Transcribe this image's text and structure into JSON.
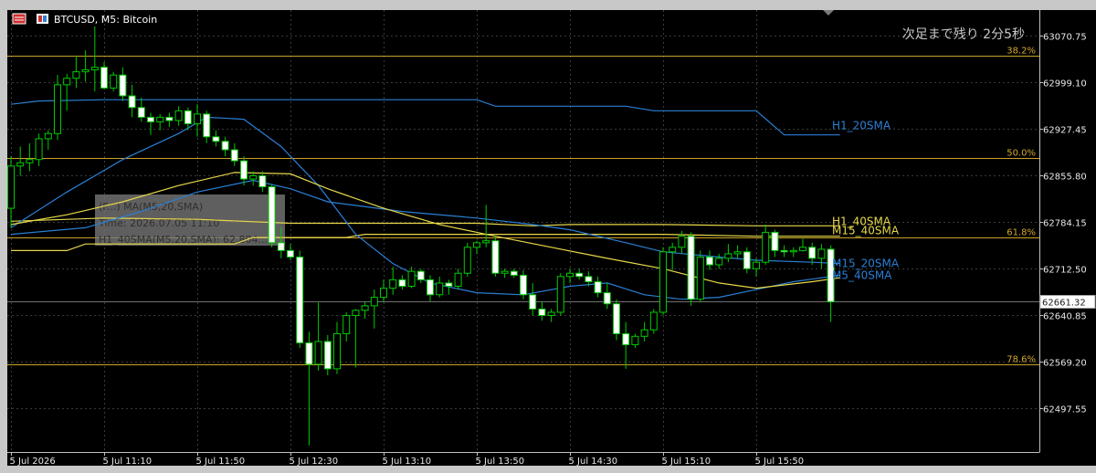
{
  "header": {
    "symbol": "BTCUSD, M5:  Bitcoin",
    "countdown": "次足まで残り 2分5秒"
  },
  "colors": {
    "background": "#000000",
    "frame": "#c8c8c8",
    "grid": "#3a3a3a",
    "bull_body": "#000000",
    "bull_wick": "#00cc00",
    "bear_body": "#ffffff",
    "fib": "#c9a227",
    "ma_blue": "#2a7fd4",
    "ma_yellow": "#e6d84a",
    "price_line": "#707070"
  },
  "tooltip": {
    "line1": "(F...)  MA(M5,20,SMA)",
    "line2": "Time: 2026.07.05 11:10",
    "line3": "H1_40SMA(M5,20,SMA): 62,804..."
  },
  "chart_data": {
    "type": "candlestick",
    "title": "BTCUSD, M5:  Bitcoin",
    "xlabel": "",
    "ylabel": "",
    "ylim": [
      62430,
      63110
    ],
    "grid": true,
    "price_axis": {
      "ticks": [
        63070.75,
        62999.1,
        62927.45,
        62855.8,
        62784.15,
        62712.5,
        62640.85,
        62569.2,
        62497.55
      ],
      "tick_labels": [
        "63070.75",
        "62999.10",
        "62927.45",
        "62855.80",
        "62784.15",
        "62712.50",
        "62640.85",
        "62569.20",
        "62497.55"
      ],
      "current_price": 62661.32,
      "current_price_label": "62661.32"
    },
    "time_axis": {
      "labels": [
        "5 Jul 2026",
        "5 Jul 11:10",
        "5 Jul 11:50",
        "5 Jul 12:30",
        "5 Jul 13:10",
        "5 Jul 13:50",
        "5 Jul 14:30",
        "5 Jul 15:10",
        "5 Jul 15:50"
      ],
      "bar_index": [
        0,
        10,
        20,
        30,
        40,
        50,
        60,
        70,
        80
      ]
    },
    "bars_total": 89,
    "candles": [
      {
        "o": 62805,
        "h": 62885,
        "l": 62775,
        "c": 62870
      },
      {
        "o": 62870,
        "h": 62900,
        "l": 62855,
        "c": 62875
      },
      {
        "o": 62875,
        "h": 62905,
        "l": 62862,
        "c": 62880
      },
      {
        "o": 62880,
        "h": 62920,
        "l": 62870,
        "c": 62912
      },
      {
        "o": 62912,
        "h": 62925,
        "l": 62895,
        "c": 62920
      },
      {
        "o": 62920,
        "h": 63010,
        "l": 62910,
        "c": 62995
      },
      {
        "o": 62995,
        "h": 63012,
        "l": 62955,
        "c": 63005
      },
      {
        "o": 63005,
        "h": 63040,
        "l": 62990,
        "c": 63015
      },
      {
        "o": 63015,
        "h": 63048,
        "l": 63000,
        "c": 63018
      },
      {
        "o": 63018,
        "h": 63085,
        "l": 62985,
        "c": 63022
      },
      {
        "o": 63022,
        "h": 63030,
        "l": 62988,
        "c": 62990
      },
      {
        "o": 62990,
        "h": 63015,
        "l": 62985,
        "c": 63010
      },
      {
        "o": 63010,
        "h": 63022,
        "l": 62970,
        "c": 62978
      },
      {
        "o": 62978,
        "h": 62995,
        "l": 62945,
        "c": 62960
      },
      {
        "o": 62960,
        "h": 62975,
        "l": 62938,
        "c": 62945
      },
      {
        "o": 62945,
        "h": 62952,
        "l": 62918,
        "c": 62938
      },
      {
        "o": 62938,
        "h": 62950,
        "l": 62925,
        "c": 62945
      },
      {
        "o": 62945,
        "h": 62952,
        "l": 62930,
        "c": 62940
      },
      {
        "o": 62940,
        "h": 62962,
        "l": 62932,
        "c": 62955
      },
      {
        "o": 62955,
        "h": 62960,
        "l": 62925,
        "c": 62935
      },
      {
        "o": 62935,
        "h": 62965,
        "l": 62915,
        "c": 62950
      },
      {
        "o": 62950,
        "h": 62955,
        "l": 62905,
        "c": 62915
      },
      {
        "o": 62915,
        "h": 62925,
        "l": 62900,
        "c": 62908
      },
      {
        "o": 62908,
        "h": 62915,
        "l": 62885,
        "c": 62895
      },
      {
        "o": 62895,
        "h": 62905,
        "l": 62870,
        "c": 62878
      },
      {
        "o": 62878,
        "h": 62885,
        "l": 62840,
        "c": 62850
      },
      {
        "o": 62850,
        "h": 62862,
        "l": 62840,
        "c": 62855
      },
      {
        "o": 62855,
        "h": 62862,
        "l": 62830,
        "c": 62838
      },
      {
        "o": 62838,
        "h": 62842,
        "l": 62745,
        "c": 62752
      },
      {
        "o": 62752,
        "h": 62775,
        "l": 62728,
        "c": 62740
      },
      {
        "o": 62740,
        "h": 62750,
        "l": 62725,
        "c": 62730
      },
      {
        "o": 62730,
        "h": 62740,
        "l": 62590,
        "c": 62598
      },
      {
        "o": 62598,
        "h": 62615,
        "l": 62440,
        "c": 62565
      },
      {
        "o": 62565,
        "h": 62660,
        "l": 62555,
        "c": 62600
      },
      {
        "o": 62600,
        "h": 62610,
        "l": 62548,
        "c": 62558
      },
      {
        "o": 62558,
        "h": 62630,
        "l": 62550,
        "c": 62612
      },
      {
        "o": 62612,
        "h": 62645,
        "l": 62600,
        "c": 62640
      },
      {
        "o": 62640,
        "h": 62650,
        "l": 62560,
        "c": 62648
      },
      {
        "o": 62648,
        "h": 62662,
        "l": 62635,
        "c": 62655
      },
      {
        "o": 62655,
        "h": 62680,
        "l": 62620,
        "c": 62668
      },
      {
        "o": 62668,
        "h": 62695,
        "l": 62660,
        "c": 62682
      },
      {
        "o": 62682,
        "h": 62715,
        "l": 62672,
        "c": 62695
      },
      {
        "o": 62695,
        "h": 62702,
        "l": 62680,
        "c": 62685
      },
      {
        "o": 62685,
        "h": 62715,
        "l": 62682,
        "c": 62708
      },
      {
        "o": 62708,
        "h": 62712,
        "l": 62690,
        "c": 62695
      },
      {
        "o": 62695,
        "h": 62702,
        "l": 62662,
        "c": 62672
      },
      {
        "o": 62672,
        "h": 62700,
        "l": 62668,
        "c": 62690
      },
      {
        "o": 62690,
        "h": 62695,
        "l": 62672,
        "c": 62685
      },
      {
        "o": 62685,
        "h": 62712,
        "l": 62680,
        "c": 62705
      },
      {
        "o": 62705,
        "h": 62752,
        "l": 62700,
        "c": 62745
      },
      {
        "o": 62745,
        "h": 62755,
        "l": 62735,
        "c": 62752
      },
      {
        "o": 62752,
        "h": 62810,
        "l": 62745,
        "c": 62755
      },
      {
        "o": 62755,
        "h": 62762,
        "l": 62700,
        "c": 62705
      },
      {
        "o": 62705,
        "h": 62712,
        "l": 62698,
        "c": 62708
      },
      {
        "o": 62708,
        "h": 62712,
        "l": 62698,
        "c": 62702
      },
      {
        "o": 62702,
        "h": 62710,
        "l": 62665,
        "c": 62672
      },
      {
        "o": 62672,
        "h": 62690,
        "l": 62640,
        "c": 62650
      },
      {
        "o": 62650,
        "h": 62662,
        "l": 62632,
        "c": 62640
      },
      {
        "o": 62640,
        "h": 62650,
        "l": 62630,
        "c": 62645
      },
      {
        "o": 62645,
        "h": 62705,
        "l": 62640,
        "c": 62700
      },
      {
        "o": 62700,
        "h": 62712,
        "l": 62690,
        "c": 62705
      },
      {
        "o": 62705,
        "h": 62712,
        "l": 62695,
        "c": 62700
      },
      {
        "o": 62700,
        "h": 62708,
        "l": 62685,
        "c": 62692
      },
      {
        "o": 62692,
        "h": 62700,
        "l": 62668,
        "c": 62675
      },
      {
        "o": 62675,
        "h": 62690,
        "l": 62650,
        "c": 62658
      },
      {
        "o": 62658,
        "h": 62665,
        "l": 62602,
        "c": 62612
      },
      {
        "o": 62612,
        "h": 62630,
        "l": 62558,
        "c": 62595
      },
      {
        "o": 62595,
        "h": 62612,
        "l": 62590,
        "c": 62608
      },
      {
        "o": 62608,
        "h": 62630,
        "l": 62600,
        "c": 62618
      },
      {
        "o": 62618,
        "h": 62650,
        "l": 62612,
        "c": 62645
      },
      {
        "o": 62645,
        "h": 62745,
        "l": 62640,
        "c": 62738
      },
      {
        "o": 62738,
        "h": 62752,
        "l": 62710,
        "c": 62745
      },
      {
        "o": 62745,
        "h": 62770,
        "l": 62735,
        "c": 62762
      },
      {
        "o": 62762,
        "h": 62768,
        "l": 62655,
        "c": 62665
      },
      {
        "o": 62665,
        "h": 62740,
        "l": 62660,
        "c": 62730
      },
      {
        "o": 62730,
        "h": 62740,
        "l": 62710,
        "c": 62718
      },
      {
        "o": 62718,
        "h": 62735,
        "l": 62712,
        "c": 62728
      },
      {
        "o": 62728,
        "h": 62750,
        "l": 62722,
        "c": 62735
      },
      {
        "o": 62735,
        "h": 62748,
        "l": 62728,
        "c": 62738
      },
      {
        "o": 62738,
        "h": 62745,
        "l": 62705,
        "c": 62712
      },
      {
        "o": 62712,
        "h": 62728,
        "l": 62700,
        "c": 62722
      },
      {
        "o": 62722,
        "h": 62780,
        "l": 62718,
        "c": 62768
      },
      {
        "o": 62768,
        "h": 62772,
        "l": 62730,
        "c": 62740
      },
      {
        "o": 62740,
        "h": 62748,
        "l": 62730,
        "c": 62738
      },
      {
        "o": 62738,
        "h": 62745,
        "l": 62730,
        "c": 62740
      },
      {
        "o": 62740,
        "h": 62758,
        "l": 62738,
        "c": 62745
      },
      {
        "o": 62745,
        "h": 62752,
        "l": 62718,
        "c": 62728
      },
      {
        "o": 62728,
        "h": 62750,
        "l": 62712,
        "c": 62742
      },
      {
        "o": 62742,
        "h": 62748,
        "l": 62630,
        "c": 62661
      }
    ],
    "series": [
      {
        "name": "H1_20SMA",
        "color": "#2a7fd4",
        "points": [
          [
            0,
            62965
          ],
          [
            3,
            62970
          ],
          [
            10,
            62972
          ],
          [
            20,
            62972
          ],
          [
            30,
            62972
          ],
          [
            40,
            62972
          ],
          [
            50,
            62972
          ],
          [
            52,
            62962
          ],
          [
            66,
            62962
          ],
          [
            69,
            62955
          ],
          [
            80,
            62955
          ],
          [
            83,
            62918
          ],
          [
            89,
            62918
          ]
        ]
      },
      {
        "name": "H1_40SMA",
        "color": "#e6d84a",
        "points": [
          [
            0,
            62785
          ],
          [
            10,
            62790
          ],
          [
            20,
            62788
          ],
          [
            30,
            62782
          ],
          [
            40,
            62782
          ],
          [
            50,
            62782
          ],
          [
            56,
            62778
          ],
          [
            60,
            62780
          ],
          [
            70,
            62780
          ],
          [
            80,
            62778
          ],
          [
            89,
            62778
          ]
        ]
      },
      {
        "name": "M15_40SMA",
        "color": "#e6d84a",
        "points": [
          [
            0,
            62740
          ],
          [
            6,
            62740
          ],
          [
            8,
            62750
          ],
          [
            24,
            62750
          ],
          [
            26,
            62760
          ],
          [
            36,
            62760
          ],
          [
            38,
            62765
          ],
          [
            66,
            62765
          ],
          [
            70,
            62765
          ],
          [
            80,
            62762
          ],
          [
            89,
            62762
          ]
        ]
      },
      {
        "name": "M15_20SMA",
        "color": "#2a7fd4",
        "points": [
          [
            0,
            62765
          ],
          [
            8,
            62775
          ],
          [
            14,
            62800
          ],
          [
            20,
            62830
          ],
          [
            26,
            62848
          ],
          [
            30,
            62835
          ],
          [
            34,
            62815
          ],
          [
            42,
            62800
          ],
          [
            50,
            62790
          ],
          [
            56,
            62780
          ],
          [
            60,
            62772
          ],
          [
            66,
            62752
          ],
          [
            70,
            62738
          ],
          [
            76,
            62730
          ],
          [
            80,
            62725
          ],
          [
            86,
            62722
          ],
          [
            89,
            62720
          ]
        ]
      },
      {
        "name": "M5_20SMA",
        "color": "#2a7fd4",
        "points": [
          [
            0,
            62775
          ],
          [
            6,
            62830
          ],
          [
            12,
            62880
          ],
          [
            18,
            62920
          ],
          [
            21,
            62945
          ],
          [
            25,
            62942
          ],
          [
            29,
            62900
          ],
          [
            33,
            62840
          ],
          [
            37,
            62765
          ],
          [
            41,
            62720
          ],
          [
            45,
            62690
          ],
          [
            50,
            62675
          ],
          [
            55,
            62672
          ],
          [
            60,
            62685
          ],
          [
            64,
            62690
          ],
          [
            68,
            62672
          ],
          [
            72,
            62665
          ],
          [
            76,
            62668
          ],
          [
            80,
            62680
          ],
          [
            84,
            62692
          ],
          [
            89,
            62702
          ]
        ]
      },
      {
        "name": "M5_40SMA",
        "color": "#e6d84a",
        "points": [
          [
            0,
            62780
          ],
          [
            6,
            62795
          ],
          [
            12,
            62815
          ],
          [
            18,
            62840
          ],
          [
            24,
            62860
          ],
          [
            30,
            62858
          ],
          [
            34,
            62835
          ],
          [
            40,
            62805
          ],
          [
            46,
            62780
          ],
          [
            52,
            62762
          ],
          [
            58,
            62745
          ],
          [
            64,
            62728
          ],
          [
            70,
            62712
          ],
          [
            76,
            62690
          ],
          [
            80,
            62682
          ],
          [
            86,
            62692
          ],
          [
            89,
            62698
          ]
        ]
      }
    ],
    "fib_levels": [
      {
        "label": "38.2%",
        "price": 63040
      },
      {
        "label": "50.0%",
        "price": 62883
      },
      {
        "label": "61.8%",
        "price": 62760
      },
      {
        "label": "78.6%",
        "price": 62565
      }
    ],
    "ma_labels": [
      {
        "text": "H1_20SMA",
        "color": "#2a7fd4",
        "price": 62932
      },
      {
        "text": "H1_40SMA",
        "color": "#e6d84a",
        "price": 62785
      },
      {
        "text": "M15_40SMA",
        "color": "#e6d84a",
        "price": 62771
      },
      {
        "text": "M15_20SMA",
        "color": "#2a7fd4",
        "price": 62720
      },
      {
        "text": "M5_40SMA",
        "color": "#2a7fd4",
        "price": 62702
      }
    ]
  }
}
